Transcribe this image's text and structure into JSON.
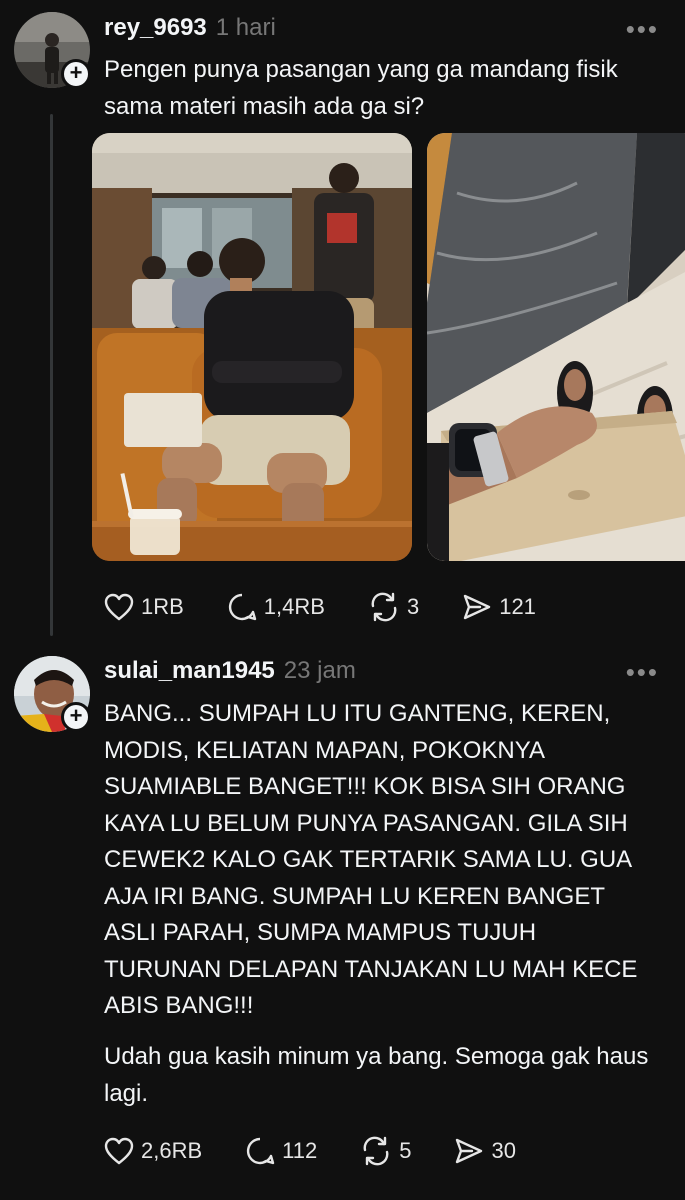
{
  "post1": {
    "username": "rey_9693",
    "time": "1 hari",
    "more": "•••",
    "text": "Pengen punya pasangan yang ga mandang fisik sama materi masih ada ga si?",
    "photos": [
      "photo-sitting-man-in-cafe",
      "photo-hand-with-smartwatch-on-tablet"
    ],
    "actions": {
      "likes": "1RB",
      "replies": "1,4RB",
      "reposts": "3",
      "shares": "121"
    }
  },
  "post2": {
    "username": "sulai_man1945",
    "time": "23 jam",
    "more": "•••",
    "text1": "BANG... SUMPAH LU ITU GANTENG, KEREN, MODIS, KELIATAN MAPAN, POKOKNYA SUAMIABLE BANGET!!! KOK BISA SIH ORANG KAYA LU BELUM PUNYA PASANGAN. GILA SIH CEWEK2 KALO GAK TERTARIK SAMA LU. GUA AJA IRI BANG. SUMPAH LU KEREN BANGET ASLI PARAH, SUMPA MAMPUS TUJUH TURUNAN DELAPAN TANJAKAN LU MAH KECE ABIS BANG!!!",
    "text2": "Udah gua kasih minum ya bang. Semoga gak haus lagi.",
    "actions": {
      "likes": "2,6RB",
      "replies": "112",
      "reposts": "5",
      "shares": "30"
    }
  },
  "colors": {
    "background": "#101010",
    "text": "#f3f5f7",
    "muted": "#777777",
    "divider": "#333638"
  },
  "icons": [
    "heart-icon",
    "comment-icon",
    "repost-icon",
    "share-icon",
    "plus-icon",
    "more-icon"
  ]
}
